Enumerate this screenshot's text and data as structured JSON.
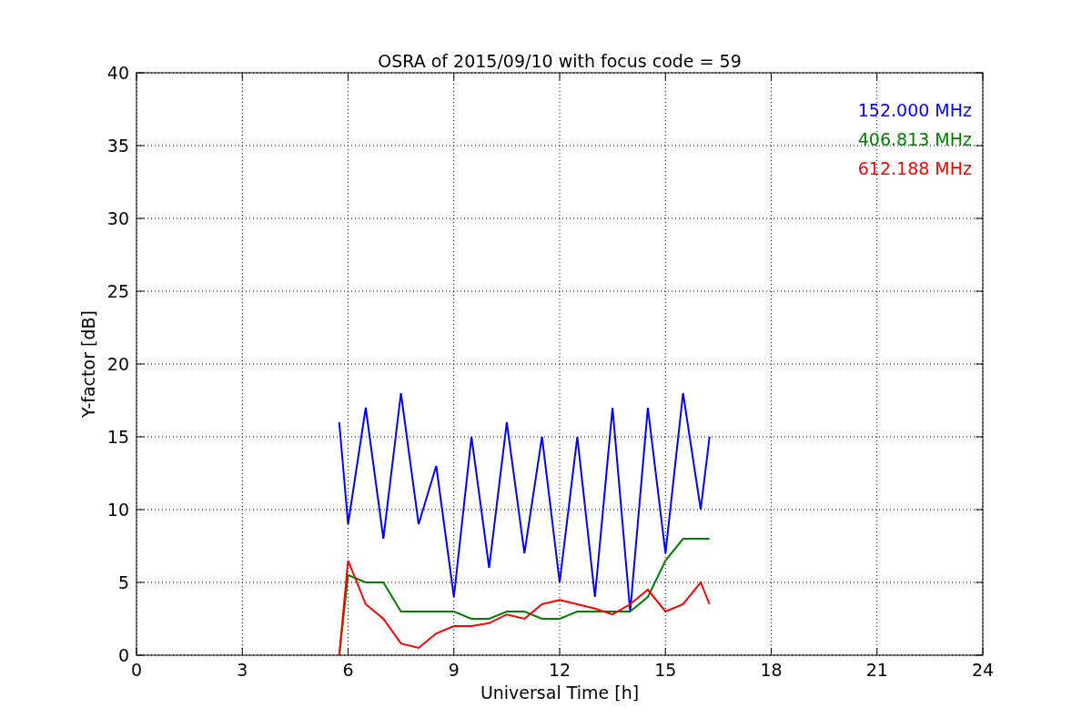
{
  "chart_data": {
    "type": "line",
    "title": "OSRA of 2015/09/10 with focus code = 59",
    "xlabel": "Universal Time [h]",
    "ylabel": "Y-factor [dB]",
    "x": [
      5.75,
      6,
      6.5,
      7,
      7.5,
      8,
      8.5,
      9,
      9.5,
      10,
      10.5,
      11,
      11.5,
      12,
      12.5,
      13,
      13.5,
      14,
      14.5,
      15,
      15.5,
      16,
      16.25
    ],
    "series": [
      {
        "name": "152.000 MHz",
        "color": "#0000ff",
        "values": [
          16,
          9,
          17,
          8,
          18,
          9,
          13,
          4,
          15,
          6,
          16,
          7,
          15,
          5,
          15,
          4,
          17,
          3,
          17,
          7,
          18,
          10,
          15
        ]
      },
      {
        "name": "406.813 MHz",
        "color": "#008000",
        "values": [
          0,
          5.5,
          5,
          5,
          3,
          3,
          3,
          3,
          2.5,
          2.5,
          3,
          3,
          2.5,
          2.5,
          3,
          3,
          3,
          3,
          4,
          6.5,
          8,
          8,
          8
        ]
      },
      {
        "name": "612.188 MHz",
        "color": "#ff0000",
        "values": [
          0,
          6.5,
          3.5,
          2.5,
          0.8,
          0.5,
          1.5,
          2,
          2,
          2.2,
          2.8,
          2.5,
          3.5,
          3.8,
          3.5,
          3.2,
          2.8,
          3.5,
          4.5,
          3,
          3.5,
          5,
          3.5
        ]
      }
    ],
    "xlim": [
      0,
      24
    ],
    "ylim": [
      0,
      40
    ],
    "xticks": [
      0,
      3,
      6,
      9,
      12,
      15,
      18,
      21,
      24
    ],
    "yticks": [
      0,
      5,
      10,
      15,
      20,
      25,
      30,
      35,
      40
    ],
    "grid": true
  }
}
